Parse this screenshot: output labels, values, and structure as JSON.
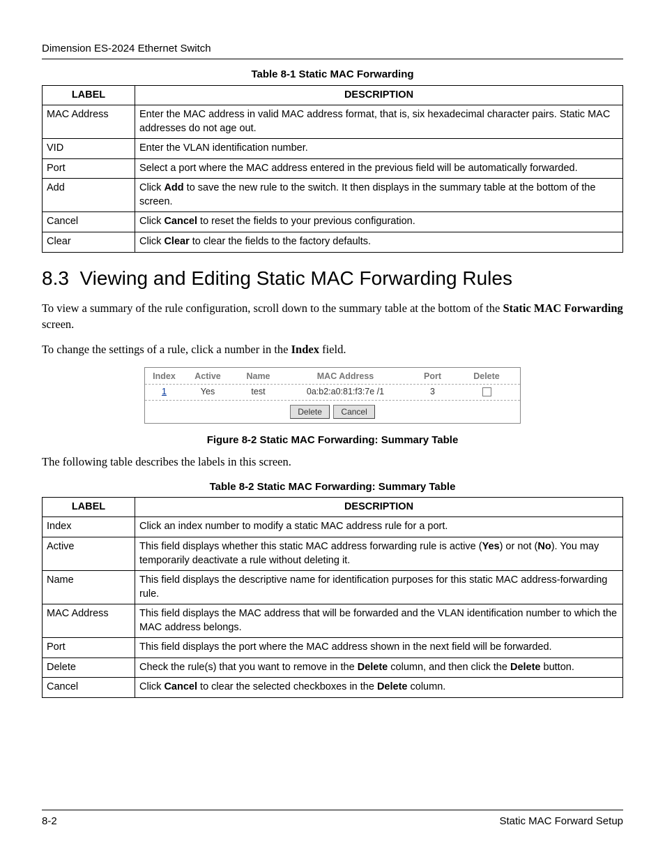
{
  "header": {
    "title": "Dimension ES-2024 Ethernet Switch"
  },
  "table1": {
    "caption": "Table 8-1 Static MAC Forwarding",
    "col_label": "LABEL",
    "col_desc": "DESCRIPTION",
    "rows": [
      {
        "label": "MAC Address",
        "desc_parts": [
          "Enter the MAC address in valid MAC address format, that is, six hexadecimal character pairs. Static MAC addresses do not age out."
        ]
      },
      {
        "label": "VID",
        "desc_parts": [
          "Enter the VLAN identification number."
        ]
      },
      {
        "label": "Port",
        "desc_parts": [
          "Select a port where the MAC address entered in the previous field will be automatically forwarded."
        ]
      },
      {
        "label": "Add",
        "desc_parts": [
          "Click ",
          {
            "b": "Add"
          },
          " to save the new rule to the switch. It then displays in the summary table at the bottom of the screen."
        ]
      },
      {
        "label": "Cancel",
        "desc_parts": [
          "Click ",
          {
            "b": "Cancel"
          },
          " to reset the fields to your previous configuration."
        ]
      },
      {
        "label": "Clear",
        "desc_parts": [
          "Click ",
          {
            "b": "Clear"
          },
          " to clear the fields to the factory defaults."
        ]
      }
    ]
  },
  "section": {
    "num": "8.3",
    "title": "Viewing and Editing Static MAC Forwarding Rules"
  },
  "para1_parts": [
    "To view a summary of the rule configuration, scroll down to the summary table at the bottom of the ",
    {
      "b": "Static MAC Forwarding"
    },
    " screen."
  ],
  "para2_parts": [
    "To change the settings of a rule, click a number in the ",
    {
      "b": "Index"
    },
    " field."
  ],
  "summary_fig": {
    "headers": {
      "index": "Index",
      "active": "Active",
      "name": "Name",
      "mac": "MAC Address",
      "port": "Port",
      "del": "Delete"
    },
    "row": {
      "index": "1",
      "active": "Yes",
      "name": "test",
      "mac": "0a:b2:a0:81:f3:7e /1",
      "port": "3"
    },
    "buttons": {
      "delete": "Delete",
      "cancel": "Cancel"
    },
    "caption": "Figure 8-2 Static MAC Forwarding: Summary Table"
  },
  "para3": "The following table describes the labels in this screen.",
  "table2": {
    "caption": "Table 8-2 Static MAC Forwarding: Summary Table",
    "col_label": "LABEL",
    "col_desc": "DESCRIPTION",
    "rows": [
      {
        "label": "Index",
        "desc_parts": [
          "Click an index number to modify a static MAC address rule for a port."
        ]
      },
      {
        "label": "Active",
        "desc_parts": [
          "This field displays whether this static MAC address forwarding rule is active (",
          {
            "b": "Yes"
          },
          ") or not (",
          {
            "b": "No"
          },
          "). You may temporarily deactivate a rule without deleting it."
        ]
      },
      {
        "label": "Name",
        "desc_parts": [
          "This field displays the descriptive name for identification purposes for this static MAC address-forwarding rule."
        ]
      },
      {
        "label": "MAC Address",
        "desc_parts": [
          "This field displays the MAC address that will be forwarded and the VLAN identification number to which the MAC address belongs."
        ]
      },
      {
        "label": "Port",
        "desc_parts": [
          "This field displays the port where the MAC address shown in the next field will be forwarded."
        ]
      },
      {
        "label": "Delete",
        "desc_parts": [
          "Check the rule(s) that you want to remove in the ",
          {
            "b": "Delete"
          },
          " column, and then click the ",
          {
            "b": "Delete"
          },
          " button."
        ]
      },
      {
        "label": "Cancel",
        "desc_parts": [
          "Click ",
          {
            "b": "Cancel"
          },
          " to clear the selected checkboxes in the ",
          {
            "b": "Delete"
          },
          " column."
        ]
      }
    ]
  },
  "footer": {
    "left": "8-2",
    "right": "Static MAC Forward Setup"
  }
}
